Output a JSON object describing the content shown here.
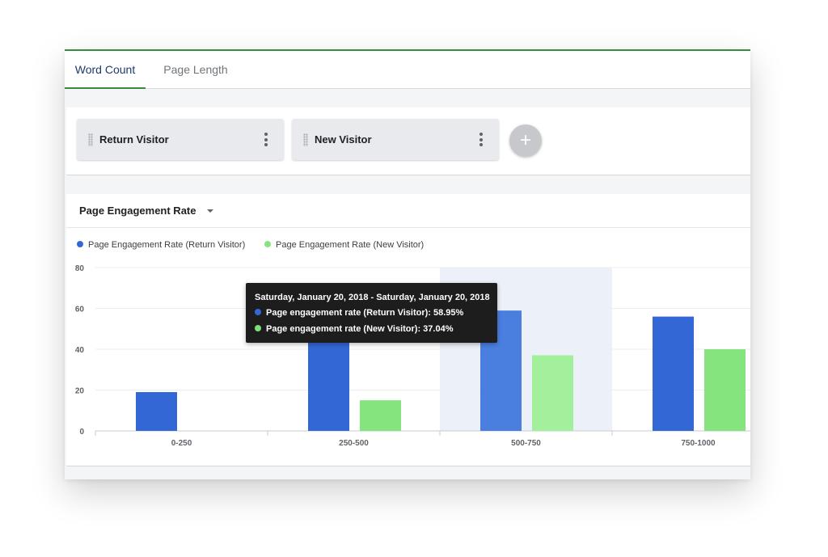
{
  "tabs": [
    {
      "label": "Word Count",
      "active": true
    },
    {
      "label": "Page Length",
      "active": false
    }
  ],
  "segments": [
    {
      "label": "Return Visitor"
    },
    {
      "label": "New Visitor"
    }
  ],
  "add_segment_label": "+",
  "metric_selector": {
    "label": "Page Engagement Rate"
  },
  "tooltip": {
    "title": "Saturday, January 20, 2018 - Saturday, January 20, 2018",
    "rows": [
      {
        "label": "Page engagement rate (Return Visitor): 58.95%",
        "color": "#3367d6"
      },
      {
        "label": "Page engagement rate (New Visitor): 37.04%",
        "color": "#7ce07a"
      }
    ]
  },
  "colors": {
    "return_visitor": "#3367d6",
    "return_visitor_highlight": "#4a7fe0",
    "new_visitor": "#86e47e",
    "new_visitor_highlight": "#a3f09c",
    "hover_band": "#ecf0f8",
    "tab_accent": "#3c8a3f"
  },
  "chart_data": {
    "type": "bar",
    "categories": [
      "0-250",
      "250-500",
      "500-750",
      "750-1000"
    ],
    "series": [
      {
        "name": "Page Engagement Rate (Return Visitor)",
        "values": [
          19,
          56,
          58.95,
          56
        ]
      },
      {
        "name": "Page Engagement Rate (New Visitor)",
        "values": [
          0,
          15,
          37.04,
          40
        ]
      }
    ],
    "ylim": [
      0,
      80
    ],
    "yticks": [
      0,
      20,
      40,
      60,
      80
    ],
    "highlighted_category": "500-750",
    "grid": true,
    "legend_position": "top-left"
  }
}
